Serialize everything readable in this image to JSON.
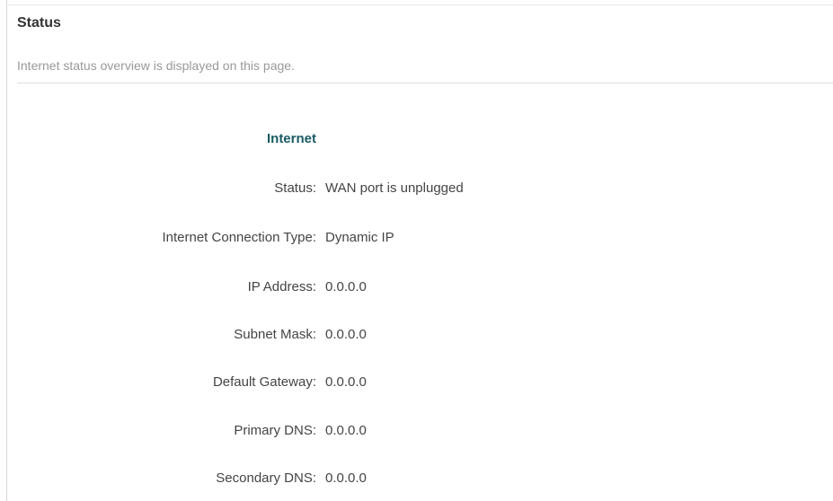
{
  "header": {
    "title": "Status",
    "description": "Internet status overview is displayed on this page."
  },
  "internet": {
    "section_title": "Internet",
    "rows": [
      {
        "label": "Status:",
        "value": "WAN port is unplugged"
      },
      {
        "label": "Internet Connection Type:",
        "value": "Dynamic IP"
      },
      {
        "label": "IP Address:",
        "value": "0.0.0.0"
      },
      {
        "label": "Subnet Mask:",
        "value": "0.0.0.0"
      },
      {
        "label": "Default Gateway:",
        "value": "0.0.0.0"
      },
      {
        "label": "Primary DNS:",
        "value": "0.0.0.0"
      },
      {
        "label": "Secondary DNS:",
        "value": "0.0.0.0"
      }
    ]
  }
}
